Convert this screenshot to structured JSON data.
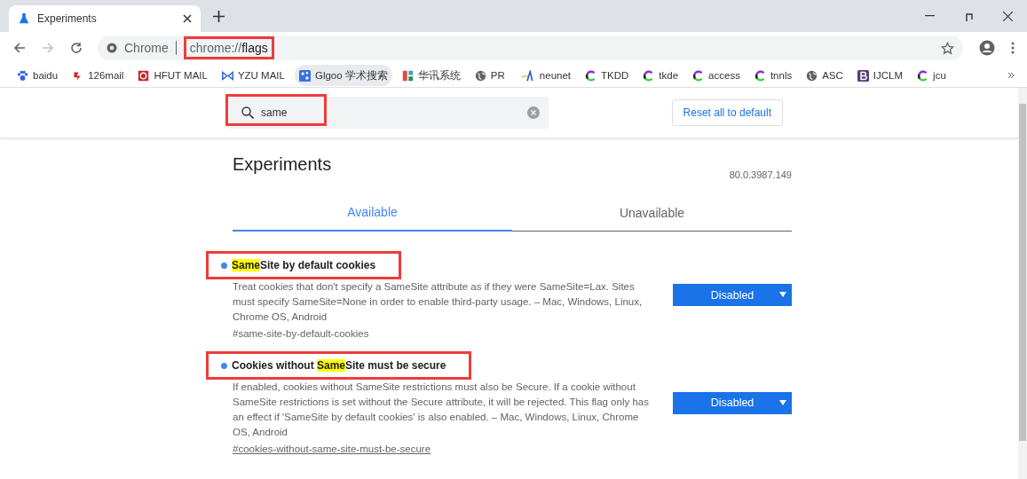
{
  "browser_tab": {
    "title": "Experiments"
  },
  "address_bar": {
    "site_label": "Chrome",
    "url_prefix": "chrome://",
    "url_path": "flags",
    "highlighted": true
  },
  "bookmarks": [
    {
      "label": "baidu",
      "kind": "paw",
      "selected": false
    },
    {
      "label": "126mail",
      "kind": "mail126",
      "selected": false
    },
    {
      "label": "HFUT MAIL",
      "kind": "at",
      "selected": false
    },
    {
      "label": "YZU MAIL",
      "kind": "bowtie",
      "selected": false
    },
    {
      "label": "Glgoo 学术搜索",
      "kind": "glgoo",
      "selected": true
    },
    {
      "label": "华讯系统",
      "kind": "bars",
      "selected": false
    },
    {
      "label": "PR",
      "kind": "globe",
      "selected": false
    },
    {
      "label": "neunet",
      "kind": "neunet",
      "selected": false
    },
    {
      "label": "TKDD",
      "kind": "ring",
      "selected": false
    },
    {
      "label": "tkde",
      "kind": "ring",
      "selected": false
    },
    {
      "label": "access",
      "kind": "ring",
      "selected": false
    },
    {
      "label": "tnnls",
      "kind": "ring",
      "selected": false
    },
    {
      "label": "ASC",
      "kind": "globe",
      "selected": false
    },
    {
      "label": "IJCLM",
      "kind": "bold",
      "selected": false
    },
    {
      "label": "jcu",
      "kind": "ring",
      "selected": false
    }
  ],
  "search": {
    "value": "same",
    "highlighted": true
  },
  "reset_button": "Reset all to default",
  "heading": "Experiments",
  "version": "80.0.3987.149",
  "tabs": [
    {
      "label": "Available",
      "selected": true
    },
    {
      "label": "Unavailable",
      "selected": false
    }
  ],
  "flags": [
    {
      "title_parts": [
        {
          "text": "Same",
          "match": true
        },
        {
          "text": "Site by default cookies",
          "match": false
        }
      ],
      "highlighted": true,
      "description": "Treat cookies that don't specify a SameSite attribute as if they were SameSite=Lax. Sites must specify SameSite=None in order to enable third-party usage. – Mac, Windows, Linux, Chrome OS, Android",
      "hash": "#same-site-by-default-cookies",
      "hash_underlined": false,
      "setting": "Disabled"
    },
    {
      "title_parts": [
        {
          "text": "Cookies without ",
          "match": false
        },
        {
          "text": "Same",
          "match": true
        },
        {
          "text": "Site must be secure",
          "match": false
        }
      ],
      "highlighted": true,
      "description": "If enabled, cookies without SameSite restrictions must also be Secure. If a cookie without SameSite restrictions is set without the Secure attribute, it will be rejected. This flag only has an effect if 'SameSite by default cookies' is also enabled. – Mac, Windows, Linux, Chrome OS, Android",
      "hash": "#cookies-without-same-site-must-be-secure",
      "hash_underlined": true,
      "setting": "Disabled"
    }
  ]
}
